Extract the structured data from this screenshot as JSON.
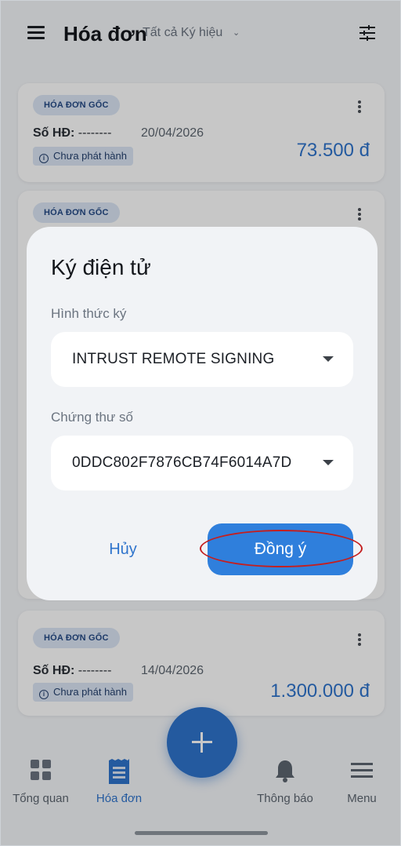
{
  "header": {
    "title": "Hóa đơn",
    "subtitle": "Tất cả Ký hiệu",
    "subtitle_chevron": "⌄"
  },
  "cards": [
    {
      "badge": "HÓA ĐƠN GỐC",
      "so_hd_label": "Số HĐ:",
      "so_hd_value": "--------",
      "date": "20/04/2026",
      "status": "Chưa phát hành",
      "amount": "73.500 đ"
    },
    {
      "badge": "HÓA ĐƠN GỐC"
    },
    {
      "badge": "HÓA ĐƠN GỐC",
      "so_hd_label": "Số HĐ:",
      "so_hd_value": "--------",
      "date": "14/04/2026",
      "status": "Chưa phát hành",
      "amount": "1.300.000 đ"
    }
  ],
  "dialog": {
    "title": "Ký điện tử",
    "sign_method_label": "Hình thức ký",
    "sign_method_value": "INTRUST REMOTE SIGNING",
    "certificate_label": "Chứng thư số",
    "certificate_value": "0DDC802F7876CB74F6014A7D",
    "cancel_label": "Hủy",
    "ok_label": "Đồng ý"
  },
  "bottom_nav": {
    "items": [
      {
        "label": "Tổng quan",
        "icon": "dashboard-icon"
      },
      {
        "label": "Hóa đơn",
        "icon": "invoice-icon",
        "active": true
      },
      {
        "label": "Thông báo",
        "icon": "bell-icon"
      },
      {
        "label": "Menu",
        "icon": "menu-icon"
      }
    ],
    "fab_icon": "plus-icon"
  },
  "colors": {
    "accent": "#2f74cc",
    "annotation": "#c41f1f"
  }
}
